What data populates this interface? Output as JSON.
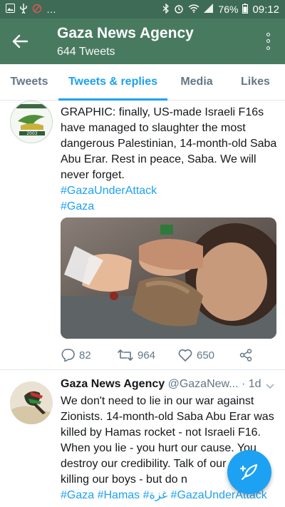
{
  "status_bar": {
    "battery": "76%",
    "time": "09:12",
    "left_icons": [
      "image-icon",
      "usb-icon",
      "signal-off-icon",
      "more-dots"
    ],
    "right_icons": [
      "bluetooth-icon",
      "alarm-icon",
      "wifi-icon",
      "signal-icon",
      "battery-icon"
    ]
  },
  "header": {
    "title": "Gaza News Agency",
    "subtitle": "644 Tweets",
    "bg_color": "#487a60"
  },
  "tabs": [
    {
      "label": "Tweets",
      "active": false
    },
    {
      "label": "Tweets & replies",
      "active": true
    },
    {
      "label": "Media",
      "active": false
    },
    {
      "label": "Likes",
      "active": false
    }
  ],
  "tweets": [
    {
      "body": "GRAPHIC: finally, US-made Israeli F16s have managed to slaughter the most dangerous Palestinian, 14-month-old Saba Abu Erar. Rest in peace, Saba. We will never forget.",
      "hashtags": [
        "#GazaUnderAttack",
        "#Gaza"
      ],
      "avatar_text": "2003",
      "replies": "82",
      "retweets": "964",
      "likes": "650"
    },
    {
      "name": "Gaza News Agency",
      "handle": "@GazaNew...",
      "time": "· 1d",
      "body": "We don't need to lie in our war against Zionists. 14-month-old Saba Abu Erar was killed by Hamas rocket - not Israeli F16. When you lie - you hurt our cause. You destroy our credibility. Talk of our snipers killing our boys - but do n",
      "hashtags": "#Gaza #Hamas #غزة #GazaUnderAttack"
    }
  ],
  "accent_color": "#1da1f2"
}
